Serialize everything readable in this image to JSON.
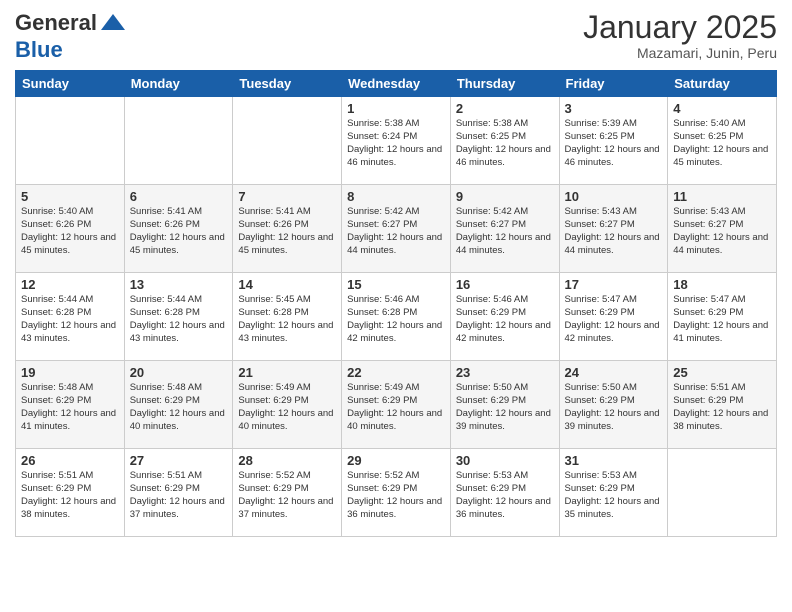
{
  "header": {
    "logo_line1": "General",
    "logo_line2": "Blue",
    "month": "January 2025",
    "location": "Mazamari, Junin, Peru"
  },
  "weekdays": [
    "Sunday",
    "Monday",
    "Tuesday",
    "Wednesday",
    "Thursday",
    "Friday",
    "Saturday"
  ],
  "weeks": [
    [
      null,
      null,
      null,
      {
        "day": 1,
        "sunrise": "5:38 AM",
        "sunset": "6:24 PM",
        "daylight": "12 hours and 46 minutes."
      },
      {
        "day": 2,
        "sunrise": "5:38 AM",
        "sunset": "6:25 PM",
        "daylight": "12 hours and 46 minutes."
      },
      {
        "day": 3,
        "sunrise": "5:39 AM",
        "sunset": "6:25 PM",
        "daylight": "12 hours and 46 minutes."
      },
      {
        "day": 4,
        "sunrise": "5:40 AM",
        "sunset": "6:25 PM",
        "daylight": "12 hours and 45 minutes."
      }
    ],
    [
      {
        "day": 5,
        "sunrise": "5:40 AM",
        "sunset": "6:26 PM",
        "daylight": "12 hours and 45 minutes."
      },
      {
        "day": 6,
        "sunrise": "5:41 AM",
        "sunset": "6:26 PM",
        "daylight": "12 hours and 45 minutes."
      },
      {
        "day": 7,
        "sunrise": "5:41 AM",
        "sunset": "6:26 PM",
        "daylight": "12 hours and 45 minutes."
      },
      {
        "day": 8,
        "sunrise": "5:42 AM",
        "sunset": "6:27 PM",
        "daylight": "12 hours and 44 minutes."
      },
      {
        "day": 9,
        "sunrise": "5:42 AM",
        "sunset": "6:27 PM",
        "daylight": "12 hours and 44 minutes."
      },
      {
        "day": 10,
        "sunrise": "5:43 AM",
        "sunset": "6:27 PM",
        "daylight": "12 hours and 44 minutes."
      },
      {
        "day": 11,
        "sunrise": "5:43 AM",
        "sunset": "6:27 PM",
        "daylight": "12 hours and 44 minutes."
      }
    ],
    [
      {
        "day": 12,
        "sunrise": "5:44 AM",
        "sunset": "6:28 PM",
        "daylight": "12 hours and 43 minutes."
      },
      {
        "day": 13,
        "sunrise": "5:44 AM",
        "sunset": "6:28 PM",
        "daylight": "12 hours and 43 minutes."
      },
      {
        "day": 14,
        "sunrise": "5:45 AM",
        "sunset": "6:28 PM",
        "daylight": "12 hours and 43 minutes."
      },
      {
        "day": 15,
        "sunrise": "5:46 AM",
        "sunset": "6:28 PM",
        "daylight": "12 hours and 42 minutes."
      },
      {
        "day": 16,
        "sunrise": "5:46 AM",
        "sunset": "6:29 PM",
        "daylight": "12 hours and 42 minutes."
      },
      {
        "day": 17,
        "sunrise": "5:47 AM",
        "sunset": "6:29 PM",
        "daylight": "12 hours and 42 minutes."
      },
      {
        "day": 18,
        "sunrise": "5:47 AM",
        "sunset": "6:29 PM",
        "daylight": "12 hours and 41 minutes."
      }
    ],
    [
      {
        "day": 19,
        "sunrise": "5:48 AM",
        "sunset": "6:29 PM",
        "daylight": "12 hours and 41 minutes."
      },
      {
        "day": 20,
        "sunrise": "5:48 AM",
        "sunset": "6:29 PM",
        "daylight": "12 hours and 40 minutes."
      },
      {
        "day": 21,
        "sunrise": "5:49 AM",
        "sunset": "6:29 PM",
        "daylight": "12 hours and 40 minutes."
      },
      {
        "day": 22,
        "sunrise": "5:49 AM",
        "sunset": "6:29 PM",
        "daylight": "12 hours and 40 minutes."
      },
      {
        "day": 23,
        "sunrise": "5:50 AM",
        "sunset": "6:29 PM",
        "daylight": "12 hours and 39 minutes."
      },
      {
        "day": 24,
        "sunrise": "5:50 AM",
        "sunset": "6:29 PM",
        "daylight": "12 hours and 39 minutes."
      },
      {
        "day": 25,
        "sunrise": "5:51 AM",
        "sunset": "6:29 PM",
        "daylight": "12 hours and 38 minutes."
      }
    ],
    [
      {
        "day": 26,
        "sunrise": "5:51 AM",
        "sunset": "6:29 PM",
        "daylight": "12 hours and 38 minutes."
      },
      {
        "day": 27,
        "sunrise": "5:51 AM",
        "sunset": "6:29 PM",
        "daylight": "12 hours and 37 minutes."
      },
      {
        "day": 28,
        "sunrise": "5:52 AM",
        "sunset": "6:29 PM",
        "daylight": "12 hours and 37 minutes."
      },
      {
        "day": 29,
        "sunrise": "5:52 AM",
        "sunset": "6:29 PM",
        "daylight": "12 hours and 36 minutes."
      },
      {
        "day": 30,
        "sunrise": "5:53 AM",
        "sunset": "6:29 PM",
        "daylight": "12 hours and 36 minutes."
      },
      {
        "day": 31,
        "sunrise": "5:53 AM",
        "sunset": "6:29 PM",
        "daylight": "12 hours and 35 minutes."
      },
      null
    ]
  ],
  "labels": {
    "sunrise_prefix": "Sunrise: ",
    "sunset_prefix": "Sunset: ",
    "daylight_label": "Daylight: "
  }
}
